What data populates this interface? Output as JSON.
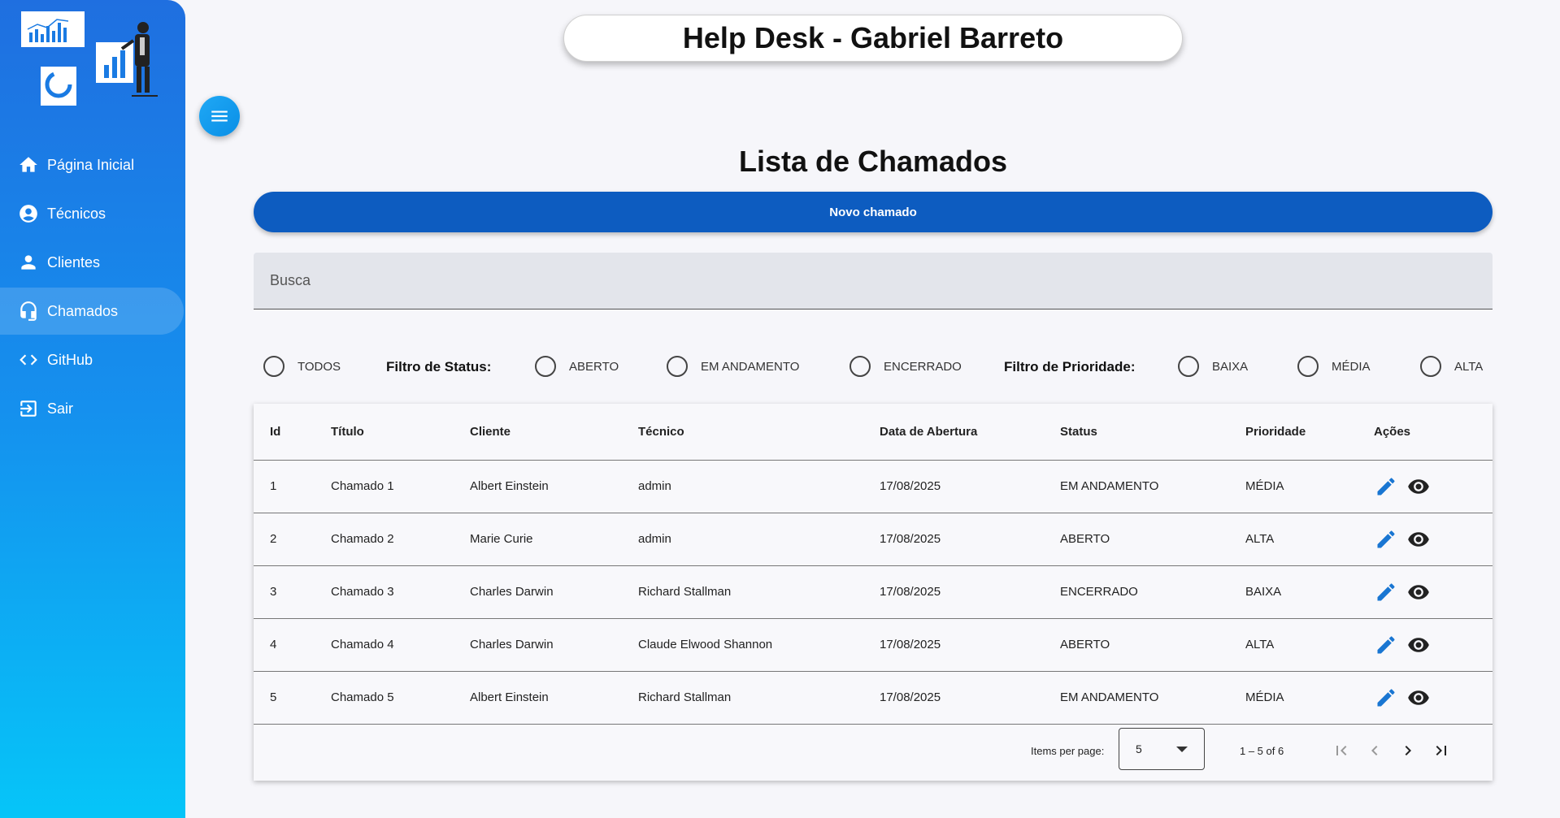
{
  "header": {
    "title": "Help Desk - Gabriel Barreto"
  },
  "sidebar": {
    "items": [
      {
        "label": "Página Inicial",
        "icon": "home-icon"
      },
      {
        "label": "Técnicos",
        "icon": "account-circle-icon"
      },
      {
        "label": "Clientes",
        "icon": "person-icon"
      },
      {
        "label": "Chamados",
        "icon": "headset-icon",
        "active": true
      },
      {
        "label": "GitHub",
        "icon": "code-icon"
      },
      {
        "label": "Sair",
        "icon": "logout-icon"
      }
    ]
  },
  "main": {
    "title": "Lista de Chamados",
    "new_button": "Novo chamado",
    "search_placeholder": "Busca",
    "filters": {
      "all": "TODOS",
      "status_label": "Filtro de Status:",
      "status_options": [
        "ABERTO",
        "EM ANDAMENTO",
        "ENCERRADO"
      ],
      "priority_label": "Filtro de Prioridade:",
      "priority_options": [
        "BAIXA",
        "MÉDIA",
        "ALTA"
      ]
    },
    "table": {
      "columns": [
        "Id",
        "Título",
        "Cliente",
        "Técnico",
        "Data de Abertura",
        "Status",
        "Prioridade",
        "Ações"
      ],
      "rows": [
        [
          "1",
          "Chamado 1",
          "Albert Einstein",
          "admin",
          "17/08/2025",
          "EM ANDAMENTO",
          "MÉDIA"
        ],
        [
          "2",
          "Chamado 2",
          "Marie Curie",
          "admin",
          "17/08/2025",
          "ABERTO",
          "ALTA"
        ],
        [
          "3",
          "Chamado 3",
          "Charles Darwin",
          "Richard Stallman",
          "17/08/2025",
          "ENCERRADO",
          "BAIXA"
        ],
        [
          "4",
          "Chamado 4",
          "Charles Darwin",
          "Claude Elwood Shannon",
          "17/08/2025",
          "ABERTO",
          "ALTA"
        ],
        [
          "5",
          "Chamado 5",
          "Albert Einstein",
          "Richard Stallman",
          "17/08/2025",
          "EM ANDAMENTO",
          "MÉDIA"
        ]
      ]
    },
    "paginator": {
      "items_per_page_label": "Items per page:",
      "items_per_page_value": "5",
      "range": "1 – 5 of 6"
    }
  },
  "colors": {
    "accent": "#0d5cc0",
    "edit_icon": "#1976d2",
    "sidebar_top": "#1f6fe0",
    "sidebar_bottom": "#06c5f8"
  }
}
